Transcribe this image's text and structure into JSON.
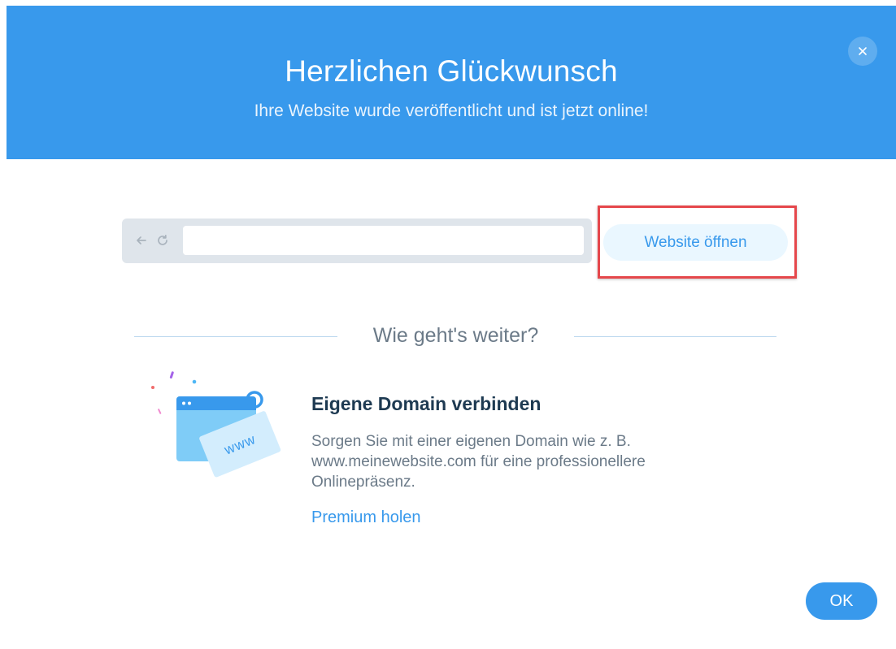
{
  "header": {
    "title": "Herzlichen Glückwunsch",
    "subtitle": "Ihre Website wurde veröffentlicht und ist jetzt online!",
    "close_icon": "close-icon"
  },
  "browser_bar": {
    "back_icon": "arrow-left-icon",
    "reload_icon": "reload-icon",
    "url_value": "",
    "open_button_label": "Website öffnen"
  },
  "next_steps": {
    "heading": "Wie geht's weiter?",
    "illustration_text": "www",
    "feature": {
      "title": "Eigene Domain verbinden",
      "description": "Sorgen Sie mit einer eigenen Domain wie z. B. www.meinewebsite.com für eine professionellere Onlinepräsenz.",
      "link_label": "Premium holen"
    }
  },
  "footer": {
    "ok_label": "OK"
  },
  "colors": {
    "header_bg": "#3899ec",
    "accent": "#3899ec",
    "highlight": "#e5474b",
    "title_dark": "#1e3a52",
    "text_muted": "#6b7a88"
  }
}
